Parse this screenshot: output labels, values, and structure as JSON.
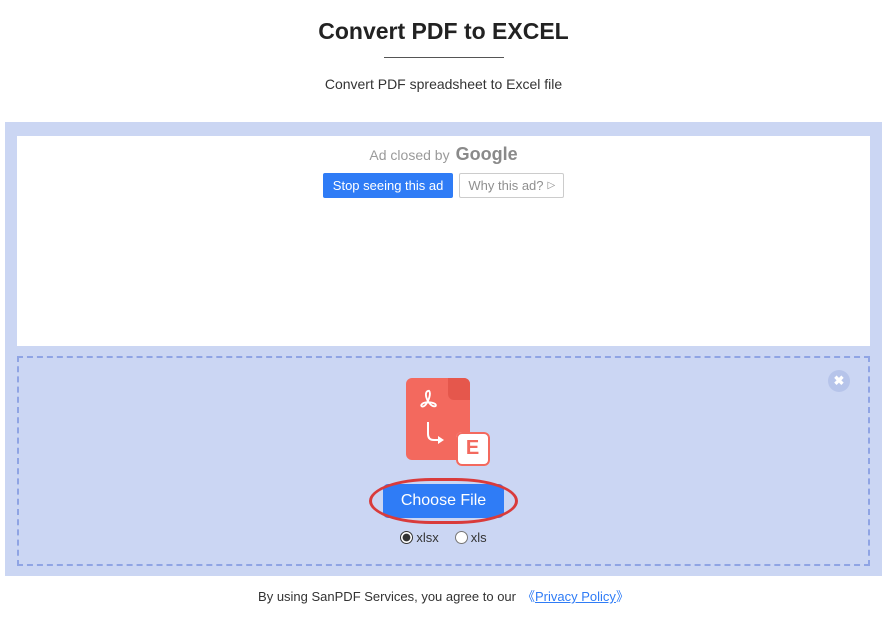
{
  "header": {
    "title": "Convert PDF to EXCEL",
    "subtitle": "Convert PDF spreadsheet to Excel file"
  },
  "ad": {
    "closed_prefix": "Ad closed by",
    "brand": "Google",
    "stop_label": "Stop seeing this ad",
    "why_label": "Why this ad?"
  },
  "dropzone": {
    "choose_label": "Choose File",
    "close_symbol": "✖",
    "formats": {
      "xlsx": "xlsx",
      "xls": "xls",
      "selected": "xlsx"
    }
  },
  "footer": {
    "prefix": "By using SanPDF Services, you agree to our",
    "open_bracket": "《",
    "policy": "Privacy Policy",
    "close_bracket": "》"
  }
}
